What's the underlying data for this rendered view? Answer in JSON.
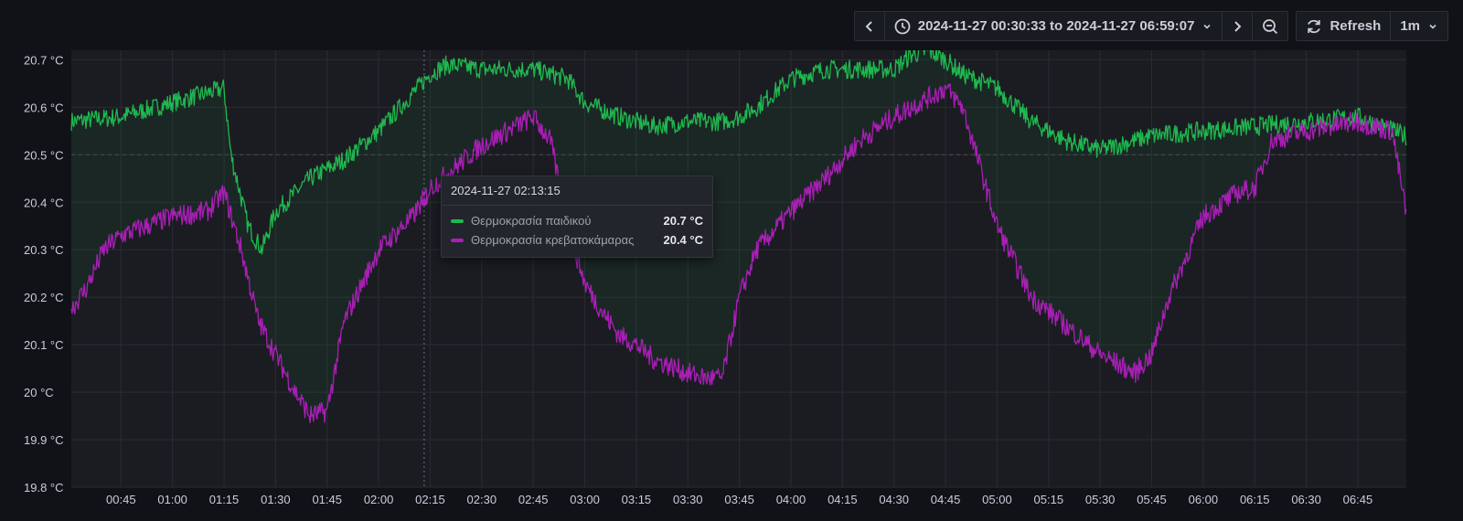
{
  "toolbar": {
    "time_range": "2024-11-27 00:30:33 to 2024-11-27 06:59:07",
    "refresh_label": "Refresh",
    "interval": "1m"
  },
  "tooltip": {
    "time": "2024-11-27 02:13:15",
    "rows": [
      {
        "name": "Θερμοκρασία παιδικού",
        "value": "20.7 °C",
        "color": "#1fb84f"
      },
      {
        "name": "Θερμοκρασία κρεβατοκάμαρας",
        "value": "20.4 °C",
        "color": "#a81fb5"
      }
    ]
  },
  "chart_data": {
    "type": "line",
    "x_label_format": "HH:MM",
    "x_range": [
      "00:30:33",
      "06:59:07"
    ],
    "x_ticks": [
      "00:45",
      "01:00",
      "01:15",
      "01:30",
      "01:45",
      "02:00",
      "02:15",
      "02:30",
      "02:45",
      "03:00",
      "03:15",
      "03:30",
      "03:45",
      "04:00",
      "04:15",
      "04:30",
      "04:45",
      "05:00",
      "05:15",
      "05:30",
      "05:45",
      "06:00",
      "06:15",
      "06:30",
      "06:45"
    ],
    "y_ticks": [
      "20.7 °C",
      "20.6 °C",
      "20.5 °C",
      "20.4 °C",
      "20.3 °C",
      "20.2 °C",
      "20.1 °C",
      "20 °C",
      "19.9 °C",
      "19.8 °C"
    ],
    "ylim": [
      19.8,
      20.72
    ],
    "grid": true,
    "series": [
      {
        "name": "Θερμοκρασία παιδικού",
        "color": "#1fb84f",
        "x": [
          "00:30",
          "00:45",
          "01:00",
          "01:15",
          "01:17",
          "01:22",
          "01:26",
          "01:30",
          "01:40",
          "01:50",
          "02:00",
          "02:10",
          "02:15",
          "02:20",
          "02:30",
          "02:45",
          "02:55",
          "03:00",
          "03:10",
          "03:20",
          "03:30",
          "03:40",
          "03:45",
          "03:50",
          "04:00",
          "04:10",
          "04:20",
          "04:30",
          "04:35",
          "04:40",
          "04:45",
          "04:50",
          "05:00",
          "05:10",
          "05:20",
          "05:30",
          "05:45",
          "06:00",
          "06:15",
          "06:30",
          "06:45",
          "06:59"
        ],
        "y": [
          20.57,
          20.58,
          20.61,
          20.64,
          20.5,
          20.35,
          20.3,
          20.38,
          20.45,
          20.49,
          20.55,
          20.63,
          20.67,
          20.69,
          20.68,
          20.68,
          20.66,
          20.61,
          20.58,
          20.56,
          20.57,
          20.57,
          20.58,
          20.6,
          20.66,
          20.68,
          20.68,
          20.68,
          20.71,
          20.72,
          20.7,
          20.67,
          20.64,
          20.57,
          20.53,
          20.51,
          20.54,
          20.55,
          20.56,
          20.57,
          20.58,
          20.54
        ]
      },
      {
        "name": "Θερμοκρασία κρεβατοκάμαρας",
        "color": "#a81fb5",
        "x": [
          "00:30",
          "00:35",
          "00:40",
          "00:45",
          "01:00",
          "01:10",
          "01:15",
          "01:20",
          "01:25",
          "01:30",
          "01:35",
          "01:40",
          "01:45",
          "01:50",
          "02:00",
          "02:10",
          "02:15",
          "02:20",
          "02:25",
          "02:30",
          "02:40",
          "02:45",
          "02:50",
          "02:55",
          "03:00",
          "03:05",
          "03:10",
          "03:15",
          "03:20",
          "03:30",
          "03:35",
          "03:40",
          "03:45",
          "03:50",
          "04:00",
          "04:10",
          "04:20",
          "04:30",
          "04:40",
          "04:45",
          "04:50",
          "05:00",
          "05:10",
          "05:20",
          "05:30",
          "05:40",
          "05:45",
          "05:50",
          "06:00",
          "06:10",
          "06:15",
          "06:20",
          "06:30",
          "06:45",
          "06:55",
          "06:59"
        ],
        "y": [
          20.17,
          20.22,
          20.3,
          20.33,
          20.37,
          20.38,
          20.42,
          20.3,
          20.15,
          20.08,
          20.01,
          19.95,
          19.96,
          20.15,
          20.3,
          20.37,
          20.43,
          20.46,
          20.49,
          20.52,
          20.56,
          20.58,
          20.53,
          20.35,
          20.23,
          20.17,
          20.12,
          20.1,
          20.07,
          20.04,
          20.03,
          20.03,
          20.2,
          20.3,
          20.38,
          20.45,
          20.53,
          20.58,
          20.62,
          20.64,
          20.6,
          20.35,
          20.2,
          20.14,
          20.08,
          20.04,
          20.08,
          20.2,
          20.37,
          20.42,
          20.43,
          20.53,
          20.55,
          20.57,
          20.55,
          20.38
        ]
      }
    ],
    "hover_time": "02:13:15"
  }
}
